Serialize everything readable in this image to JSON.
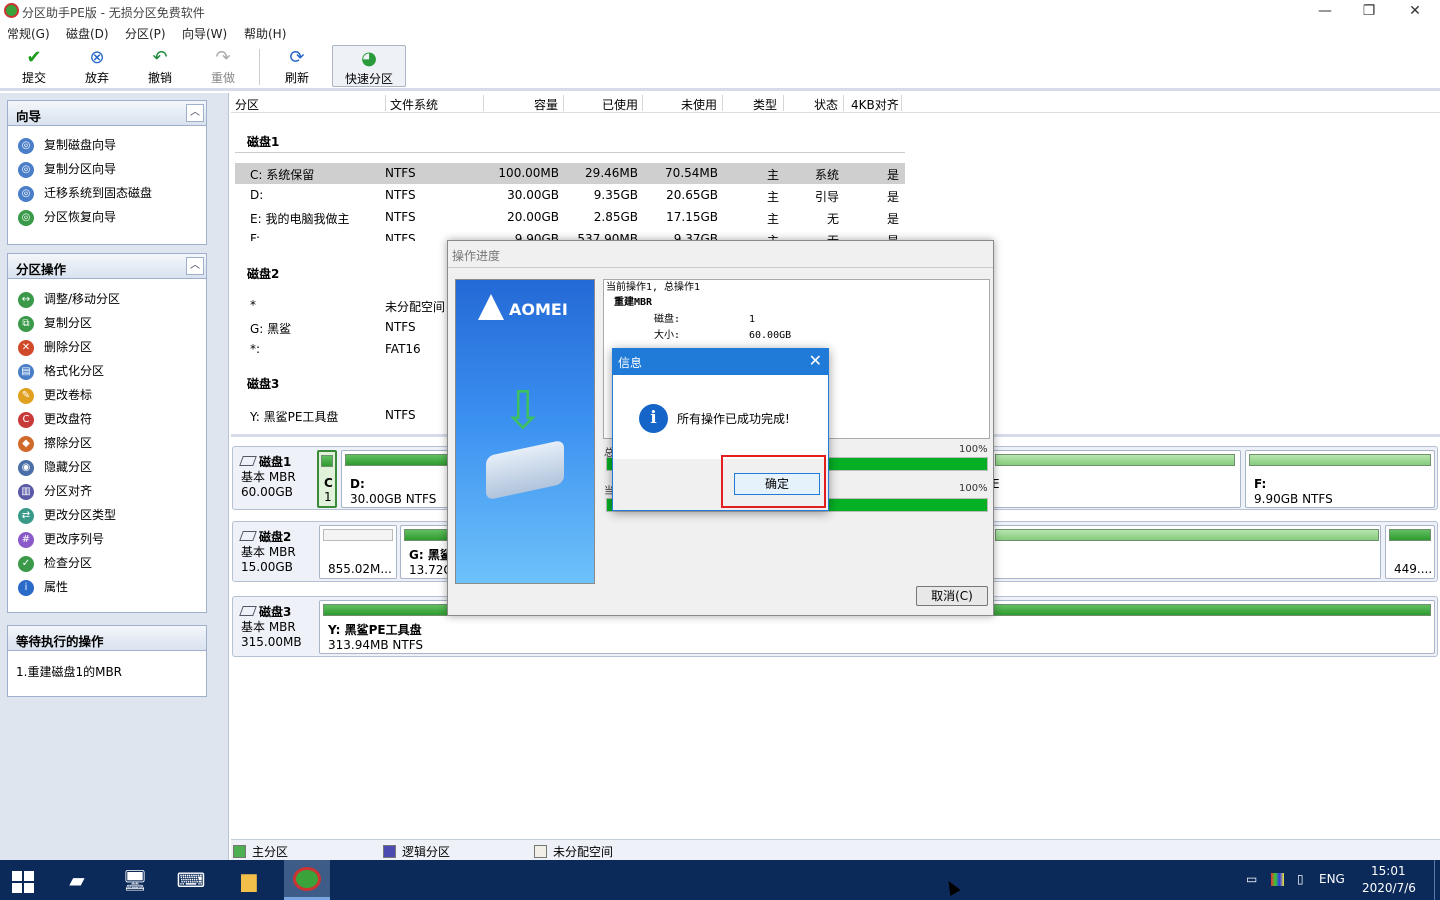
{
  "window": {
    "title": "分区助手PE版 - 无损分区免费软件",
    "minimize": "—",
    "restore": "❐",
    "close": "✕"
  },
  "menu": [
    "常规(G)",
    "磁盘(D)",
    "分区(P)",
    "向导(W)",
    "帮助(H)"
  ],
  "toolbar": {
    "submit": "提交",
    "discard": "放弃",
    "undo": "撤销",
    "redo": "重做",
    "refresh": "刷新",
    "quick": "快速分区"
  },
  "wizard_panel": {
    "title": "向导",
    "items": [
      "复制磁盘向导",
      "复制分区向导",
      "迁移系统到固态磁盘",
      "分区恢复向导"
    ]
  },
  "ops_panel": {
    "title": "分区操作",
    "items": [
      "调整/移动分区",
      "复制分区",
      "删除分区",
      "格式化分区",
      "更改卷标",
      "更改盘符",
      "擦除分区",
      "隐藏分区",
      "分区对齐",
      "更改分区类型",
      "更改序列号",
      "检查分区",
      "属性"
    ]
  },
  "pending_panel": {
    "title": "等待执行的操作",
    "items": [
      "1.重建磁盘1的MBR"
    ]
  },
  "columns": [
    "分区",
    "文件系统",
    "容量",
    "已使用",
    "未使用",
    "类型",
    "状态",
    "4KB对齐"
  ],
  "disks": [
    {
      "name": "磁盘1",
      "rows": [
        [
          "C: 系统保留",
          "NTFS",
          "100.00MB",
          "29.46MB",
          "70.54MB",
          "主",
          "系统",
          "是"
        ],
        [
          "D:",
          "NTFS",
          "30.00GB",
          "9.35GB",
          "20.65GB",
          "主",
          "引导",
          "是"
        ],
        [
          "E: 我的电脑我做主",
          "NTFS",
          "20.00GB",
          "2.85GB",
          "17.15GB",
          "主",
          "无",
          "是"
        ],
        [
          "F:",
          "NTFS",
          "9.90GB",
          "537.90MB",
          "9.37GB",
          "主",
          "无",
          "是"
        ]
      ]
    },
    {
      "name": "磁盘2",
      "rows": [
        [
          "*",
          "未分配空间",
          "",
          "",
          "",
          "",
          "",
          ""
        ],
        [
          "G: 黑鲨",
          "NTFS",
          "",
          "",
          "",
          "",
          "",
          ""
        ],
        [
          "*:",
          "FAT16",
          "",
          "",
          "",
          "",
          "",
          ""
        ]
      ]
    },
    {
      "name": "磁盘3",
      "rows": [
        [
          "Y: 黑鲨PE工具盘",
          "NTFS",
          "",
          "",
          "",
          "",
          "",
          ""
        ]
      ]
    }
  ],
  "diskmap": {
    "disk1": {
      "name": "磁盘1",
      "type": "基本 MBR",
      "size": "60.00GB",
      "c_letter": "C",
      "c_num": "1",
      "d_name": "D:",
      "d_size": "30.00GB NTFS",
      "e_tail": "E",
      "f_name": "F:",
      "f_size": "9.90GB NTFS"
    },
    "disk2": {
      "name": "磁盘2",
      "type": "基本 MBR",
      "size": "15.00GB",
      "un_size": "855.02M...",
      "g_name": "G: 黑鲨",
      "g_size": "13.72G",
      "last_size": "449...."
    },
    "disk3": {
      "name": "磁盘3",
      "type": "基本 MBR",
      "size": "315.00MB",
      "y_name": "Y: 黑鲨PE工具盘",
      "y_size": "313.94MB NTFS"
    }
  },
  "legend": {
    "primary": "主分区",
    "logical": "逻辑分区",
    "unalloc": "未分配空间"
  },
  "progress_dialog": {
    "title": "操作进度",
    "brand": "AOMEI",
    "log": {
      "line1": "当前操作1, 总操作1",
      "line2": "重建MBR",
      "disk_key": "磁盘:",
      "disk_val": "1",
      "size_key": "大小:",
      "size_val": "60.00GB"
    },
    "bar1_label": "总",
    "bar1_pct": "100%",
    "bar1_value": 1.0,
    "bar2_label": "当",
    "bar2_pct": "100%",
    "bar2_value": 1.0,
    "cancel": "取消(C)"
  },
  "info_dialog": {
    "title": "信息",
    "icon": "i",
    "message": "所有操作已成功完成!",
    "ok": "确定"
  },
  "taskbar": {
    "lang": "ENG",
    "time": "15:01",
    "date": "2020/7/6"
  },
  "colors": {
    "primary": "#2f9a2f",
    "accent": "#1f7ad8",
    "highlight": "#e21e1e",
    "taskbar": "#0b2a5a"
  }
}
